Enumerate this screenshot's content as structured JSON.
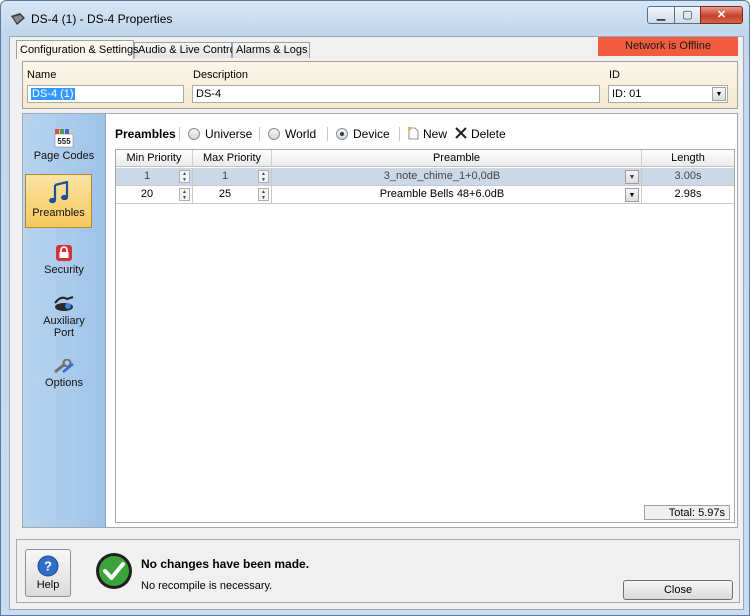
{
  "window": {
    "title": "DS-4 (1) - DS-4 Properties",
    "minimize": "▁",
    "maximize": "▢",
    "close": "✕"
  },
  "tabs": [
    {
      "label": "Configuration & Settings",
      "active": true
    },
    {
      "label": "Audio & Live Control",
      "active": false
    },
    {
      "label": "Alarms & Logs",
      "active": false
    }
  ],
  "network_status": "Network is Offline",
  "header": {
    "name_label": "Name",
    "name_value": "DS-4 (1)",
    "description_label": "Description",
    "description_value": "DS-4",
    "id_label": "ID",
    "id_value": "ID: 01"
  },
  "sidebar": {
    "items": [
      {
        "label": "Page Codes",
        "icon": "page-codes-icon",
        "icon_text": "555"
      },
      {
        "label": "Preambles",
        "icon": "music-note-icon",
        "icon_text": "♫"
      },
      {
        "label": "Security",
        "icon": "lock-icon"
      },
      {
        "label": "Auxiliary Port",
        "label_line1": "Auxiliary",
        "label_line2": "Port",
        "icon": "auxiliary-port-icon"
      },
      {
        "label": "Options",
        "icon": "wrench-icon"
      }
    ]
  },
  "toolbar": {
    "title": "Preambles",
    "radio_universe": "Universe",
    "radio_world": "World",
    "radio_device": "Device",
    "selected_scope": "Device",
    "new_label": "New",
    "delete_label": "Delete"
  },
  "table": {
    "columns": [
      "Min Priority",
      "Max Priority",
      "Preamble",
      "Length"
    ],
    "rows": [
      {
        "min": "1",
        "max": "1",
        "preamble": "3_note_chime_1+0,0dB",
        "length": "3.00s",
        "selected": true
      },
      {
        "min": "20",
        "max": "25",
        "preamble": "Preamble Bells 48+6.0dB",
        "length": "2.98s",
        "selected": false
      }
    ],
    "total": "Total: 5.97s"
  },
  "footer": {
    "help_label": "Help",
    "help_icon_text": "?",
    "message_title": "No changes have been made.",
    "message_subtitle": "No recompile is necessary.",
    "close_label": "Close"
  },
  "colors": {
    "offline": "#f35b3e",
    "sidebar": "#a9cbec",
    "selected_nav": "#f7c95e",
    "header_panel": "#f4e9cf"
  }
}
